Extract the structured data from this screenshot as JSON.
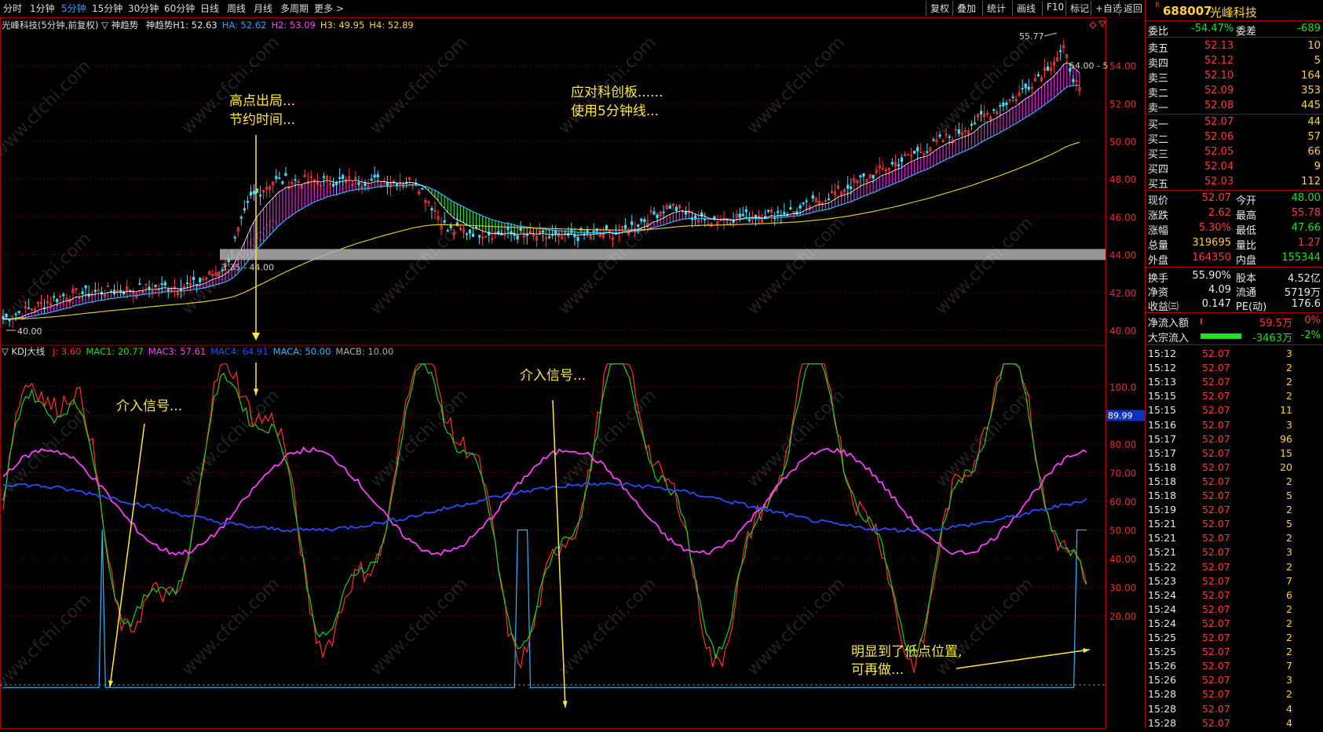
{
  "toolbar": {
    "periods": [
      "分时",
      "1分钟",
      "5分钟",
      "15分钟",
      "30分钟",
      "60分钟",
      "日线",
      "周线",
      "月线",
      "多周期",
      "更多 >"
    ],
    "active_period": "5分钟",
    "buttons": [
      "复权",
      "叠加",
      "统计",
      "画线",
      "F10",
      "标记",
      "+自选",
      "返回"
    ]
  },
  "main_chart": {
    "title": "光峰科技(5分钟,前复权)",
    "indicator_name": "▽ 神趋势",
    "legend": [
      {
        "label": "神趋势H1: 52.63",
        "color": "#e0e0e0"
      },
      {
        "label": "HA: 52.62",
        "color": "#2aa0ff"
      },
      {
        "label": "H2: 53.09",
        "color": "#ff40ff"
      },
      {
        "label": "H3: 49.95",
        "color": "#ffd23c"
      },
      {
        "label": "H4: 52.89",
        "color": "#ffd23c"
      }
    ],
    "y_ticks": [
      "54.00",
      "52.00",
      "50.00",
      "48.00",
      "46.00",
      "44.00",
      "42.00",
      "40.00"
    ],
    "label_high": "55.77",
    "label_low": "40.00",
    "label_range_right": "54.00 - 5",
    "label_range_left": "3.35 - 44.00",
    "annotation_1_line1": "高点出局...",
    "annotation_1_line2": "节约时间...",
    "annotation_2_line1": "应对科创板......",
    "annotation_2_line2": "使用5分钟线..."
  },
  "sub_chart": {
    "indicator_name": "▽ KDJ大线",
    "legend": [
      {
        "label": "J: 3.60",
        "color": "#ff3030"
      },
      {
        "label": "MAC1: 20.77",
        "color": "#20e020"
      },
      {
        "label": "MAC3: 57.61",
        "color": "#ff40ff"
      },
      {
        "label": "MAC4: 64.91",
        "color": "#2a4bff"
      },
      {
        "label": "MACA: 50.00",
        "color": "#2ab8ff"
      },
      {
        "label": "MACB: 10.00",
        "color": "#aaaaaa"
      }
    ],
    "y_ticks": [
      "100.0",
      "90.00",
      "80.00",
      "70.00",
      "60.00",
      "50.00",
      "40.00",
      "30.00",
      "20.00"
    ],
    "current_value_badge": "89.99",
    "annotation_signal_1": "介入信号...",
    "annotation_signal_2": "介入信号...",
    "annotation_low_line1": "明显到了低点位置,",
    "annotation_low_line2": "可再做..."
  },
  "watermark": "www.cfchi.com",
  "quote_panel": {
    "code": "688007",
    "name": "光峰科技",
    "weibi_label": "委比",
    "weibi_value": "-54.47%",
    "weicha_label": "委差",
    "weicha_value": "-689",
    "asks": [
      {
        "label": "卖五",
        "price": "52.13",
        "vol": "10"
      },
      {
        "label": "卖四",
        "price": "52.12",
        "vol": "5"
      },
      {
        "label": "卖三",
        "price": "52.10",
        "vol": "164"
      },
      {
        "label": "卖二",
        "price": "52.09",
        "vol": "353"
      },
      {
        "label": "卖一",
        "price": "52.08",
        "vol": "445"
      }
    ],
    "bids": [
      {
        "label": "买一",
        "price": "52.07",
        "vol": "44"
      },
      {
        "label": "买二",
        "price": "52.06",
        "vol": "57"
      },
      {
        "label": "买三",
        "price": "52.05",
        "vol": "66"
      },
      {
        "label": "买四",
        "price": "52.04",
        "vol": "9"
      },
      {
        "label": "买五",
        "price": "52.03",
        "vol": "112"
      }
    ],
    "stats": [
      {
        "l1": "现价",
        "v1": "52.07",
        "c1": "red",
        "l2": "今开",
        "v2": "48.00",
        "c2": "green"
      },
      {
        "l1": "涨跌",
        "v1": "2.62",
        "c1": "red",
        "l2": "最高",
        "v2": "55.78",
        "c2": "red"
      },
      {
        "l1": "涨幅",
        "v1": "5.30%",
        "c1": "red",
        "l2": "最低",
        "v2": "47.66",
        "c2": "green"
      },
      {
        "l1": "总量",
        "v1": "319695",
        "c1": "yellow",
        "l2": "量比",
        "v2": "1.27",
        "c2": "red"
      },
      {
        "l1": "外盘",
        "v1": "164350",
        "c1": "red",
        "l2": "内盘",
        "v2": "155344",
        "c2": "green"
      }
    ],
    "stats2": [
      {
        "l1": "换手",
        "v1": "55.90%",
        "l2": "股本",
        "v2": "4.52亿"
      },
      {
        "l1": "净资",
        "v1": "4.09",
        "l2": "流通",
        "v2": "5719万"
      },
      {
        "l1": "收益㈢",
        "v1": "0.147",
        "l2": "PE(动)",
        "v2": "176.6"
      }
    ],
    "flow": [
      {
        "label": "净流入额",
        "value": "59.5万",
        "pct": "0%",
        "vcolor": "red",
        "bar": "red"
      },
      {
        "label": "大宗流入",
        "value": "-3463万",
        "pct": "-2%",
        "vcolor": "green",
        "bar": "green"
      }
    ],
    "ticks": [
      {
        "t": "15:12",
        "p": "52.07",
        "v": "3"
      },
      {
        "t": "15:12",
        "p": "52.07",
        "v": "2"
      },
      {
        "t": "15:13",
        "p": "52.07",
        "v": "2"
      },
      {
        "t": "15:15",
        "p": "52.07",
        "v": "2"
      },
      {
        "t": "15:15",
        "p": "52.07",
        "v": "11"
      },
      {
        "t": "15:16",
        "p": "52.07",
        "v": "3"
      },
      {
        "t": "15:17",
        "p": "52.07",
        "v": "96"
      },
      {
        "t": "15:17",
        "p": "52.07",
        "v": "15"
      },
      {
        "t": "15:18",
        "p": "52.07",
        "v": "20"
      },
      {
        "t": "15:18",
        "p": "52.07",
        "v": "2"
      },
      {
        "t": "15:18",
        "p": "52.07",
        "v": "5"
      },
      {
        "t": "15:19",
        "p": "52.07",
        "v": "2"
      },
      {
        "t": "15:21",
        "p": "52.07",
        "v": "5"
      },
      {
        "t": "15:21",
        "p": "52.07",
        "v": "2"
      },
      {
        "t": "15:21",
        "p": "52.07",
        "v": "3"
      },
      {
        "t": "15:22",
        "p": "52.07",
        "v": "2"
      },
      {
        "t": "15:23",
        "p": "52.07",
        "v": "7"
      },
      {
        "t": "15:24",
        "p": "52.07",
        "v": "6"
      },
      {
        "t": "15:24",
        "p": "52.07",
        "v": "2"
      },
      {
        "t": "15:24",
        "p": "52.07",
        "v": "2"
      },
      {
        "t": "15:25",
        "p": "52.07",
        "v": "2"
      },
      {
        "t": "15:25",
        "p": "52.07",
        "v": "2"
      },
      {
        "t": "15:26",
        "p": "52.07",
        "v": "7"
      },
      {
        "t": "15:26",
        "p": "52.07",
        "v": "3"
      },
      {
        "t": "15:28",
        "p": "52.07",
        "v": "2"
      },
      {
        "t": "15:28",
        "p": "52.07",
        "v": "4"
      },
      {
        "t": "15:28",
        "p": "52.07",
        "v": "4"
      }
    ]
  }
}
